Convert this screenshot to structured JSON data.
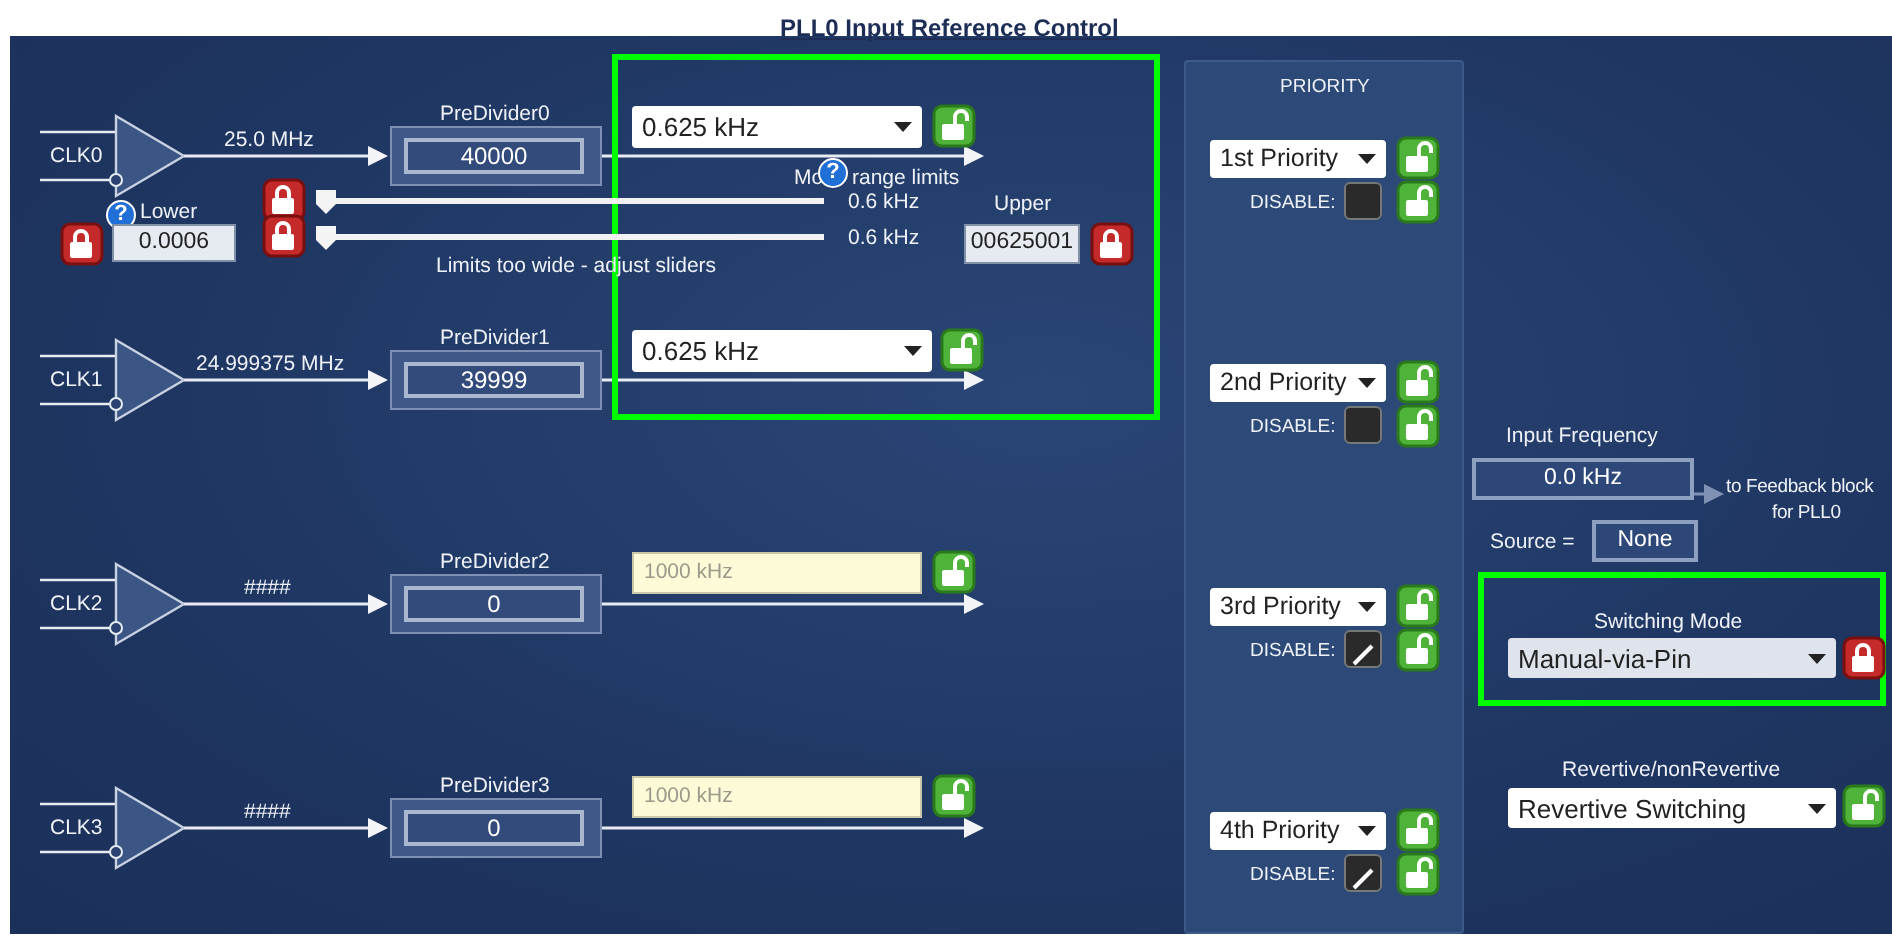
{
  "title": "PLL0 Input Reference Control",
  "inputs": [
    {
      "label": "CLK0",
      "frequency": "25.0 MHz",
      "predivider": {
        "label": "PreDivider0",
        "value": "40000"
      },
      "output": {
        "kind": "dropdown",
        "value": "0.625 kHz"
      },
      "locked": false
    },
    {
      "label": "CLK1",
      "frequency": "24.999375 MHz",
      "predivider": {
        "label": "PreDivider1",
        "value": "39999"
      },
      "output": {
        "kind": "dropdown",
        "value": "0.625 kHz"
      },
      "locked": false
    },
    {
      "label": "CLK2",
      "frequency": "####",
      "predivider": {
        "label": "PreDivider2",
        "value": "0"
      },
      "output": {
        "kind": "field",
        "value": "1000 kHz",
        "disabled": true
      },
      "locked": false
    },
    {
      "label": "CLK3",
      "frequency": "####",
      "predivider": {
        "label": "PreDivider3",
        "value": "0"
      },
      "output": {
        "kind": "field",
        "value": "1000 kHz",
        "disabled": true
      },
      "locked": false
    }
  ],
  "range_limits": {
    "lower": {
      "help": "?",
      "label": "Lower",
      "value": "0.0006",
      "locked": true
    },
    "heading_start": "Mo",
    "heading_help": "?",
    "heading_end": "range limits",
    "sliders": [
      {
        "locked": true,
        "level": 0,
        "reading": "0.6 kHz"
      },
      {
        "locked": true,
        "level": 0,
        "reading": "0.6 kHz"
      }
    ],
    "message": "Limits too wide - adjust sliders",
    "upper": {
      "label": "Upper",
      "value": "00625001",
      "locked": true
    }
  },
  "priority": {
    "heading": "PRIORITY",
    "items": [
      {
        "value": "1st Priority",
        "locked": false,
        "disable_label": "DISABLE:",
        "checked": false,
        "disable_locked": false
      },
      {
        "value": "2nd Priority",
        "locked": false,
        "disable_label": "DISABLE:",
        "checked": false,
        "disable_locked": false
      },
      {
        "value": "3rd Priority",
        "locked": false,
        "disable_label": "DISABLE:",
        "checked": true,
        "disable_locked": false
      },
      {
        "value": "4th Priority",
        "locked": false,
        "disable_label": "DISABLE:",
        "checked": true,
        "disable_locked": false
      }
    ]
  },
  "input_frequency": {
    "label": "Input Frequency",
    "value": "0.0 kHz",
    "note": [
      "to Feedback block",
      "for PLL0"
    ]
  },
  "source": {
    "label": "Source =",
    "value": "None"
  },
  "switching_mode": {
    "label": "Switching Mode",
    "value": "Manual-via-Pin",
    "locked": true
  },
  "revertive": {
    "label": "Revertive/nonRevertive",
    "value": "Revertive Switching",
    "locked": false
  }
}
